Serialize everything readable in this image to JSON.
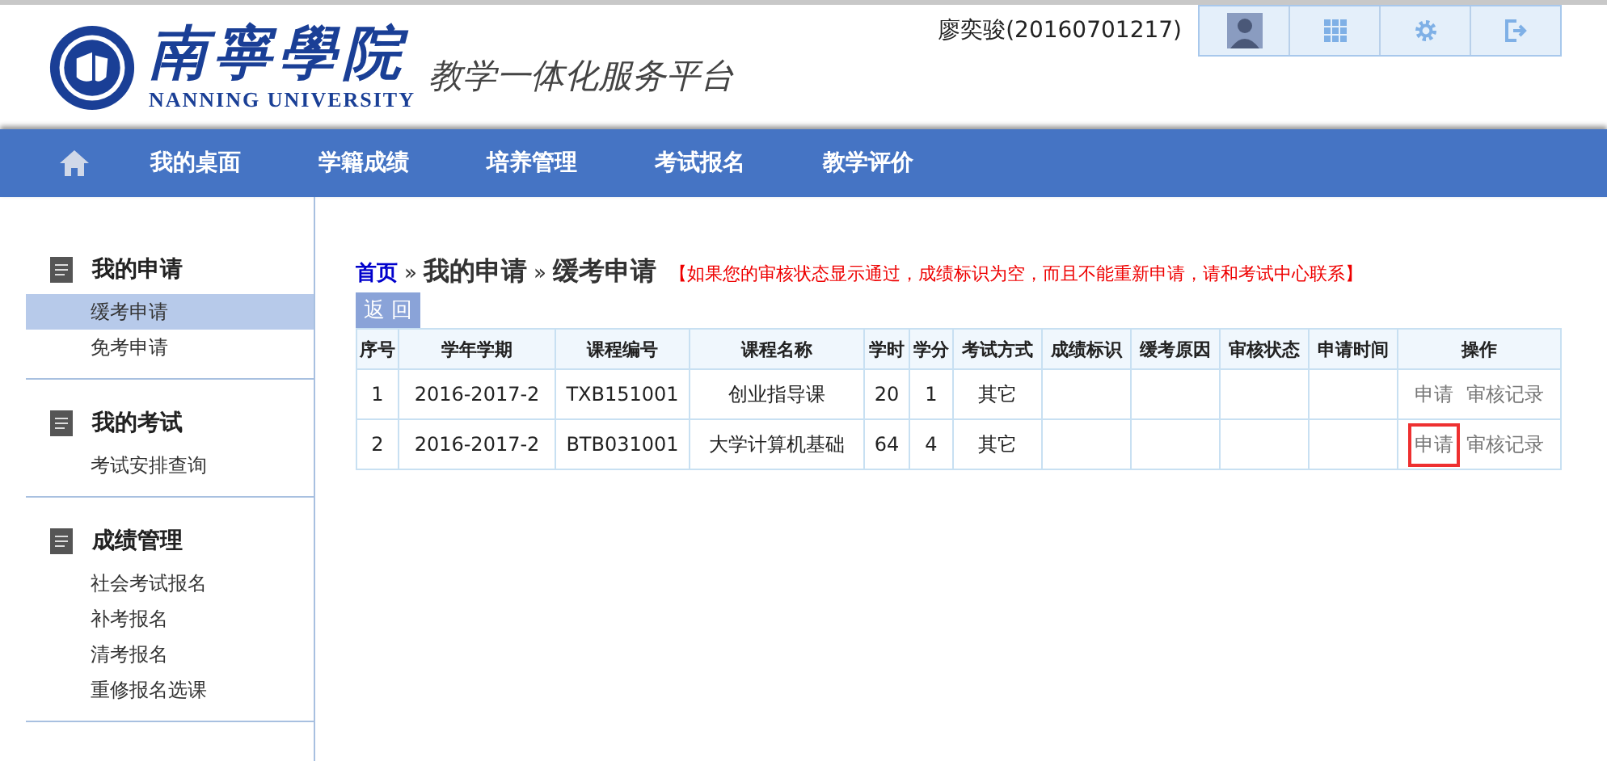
{
  "header": {
    "logo_title": "南寧學院",
    "logo_subtitle": "NANNING UNIVERSITY",
    "platform_title": "教学一体化服务平台",
    "user": "廖奕骏(20160701217)"
  },
  "nav": [
    {
      "label": "我的桌面"
    },
    {
      "label": "学籍成绩"
    },
    {
      "label": "培养管理"
    },
    {
      "label": "考试报名"
    },
    {
      "label": "教学评价"
    }
  ],
  "sidebar": [
    {
      "title": "我的申请",
      "items": [
        {
          "label": "缓考申请",
          "selected": true
        },
        {
          "label": "免考申请",
          "selected": false
        }
      ]
    },
    {
      "title": "我的考试",
      "items": [
        {
          "label": "考试安排查询",
          "selected": false
        }
      ]
    },
    {
      "title": "成绩管理",
      "items": [
        {
          "label": "社会考试报名",
          "selected": false
        },
        {
          "label": "补考报名",
          "selected": false
        },
        {
          "label": "清考报名",
          "selected": false
        },
        {
          "label": "重修报名选课",
          "selected": false
        }
      ]
    }
  ],
  "breadcrumb": [
    {
      "label": "首页",
      "kind": "link"
    },
    {
      "label": "»",
      "kind": "sep"
    },
    {
      "label": "我的申请",
      "kind": "text"
    },
    {
      "label": "»",
      "kind": "sep"
    },
    {
      "label": "缓考申请",
      "kind": "text"
    }
  ],
  "notice": "【如果您的审核状态显示通过，成绩标识为空，而且不能重新申请，请和考试中心联系】",
  "back_button": "返 回",
  "table": {
    "columns": [
      "序号",
      "学年学期",
      "课程编号",
      "课程名称",
      "学时",
      "学分",
      "考试方式",
      "成绩标识",
      "缓考原因",
      "审核状态",
      "申请时间",
      "操作"
    ],
    "rows": [
      {
        "cells": [
          "1",
          "2016-2017-2",
          "TXB151001",
          "创业指导课",
          "20",
          "1",
          "其它"
        ],
        "apply": "申请",
        "apply_highlighted": false,
        "record": "审核记录"
      },
      {
        "cells": [
          "2",
          "2016-2017-2",
          "BTB031001",
          "大学计算机基础",
          "64",
          "4",
          "其它"
        ],
        "apply": "申请",
        "apply_highlighted": true,
        "record": "审核记录"
      }
    ]
  }
}
